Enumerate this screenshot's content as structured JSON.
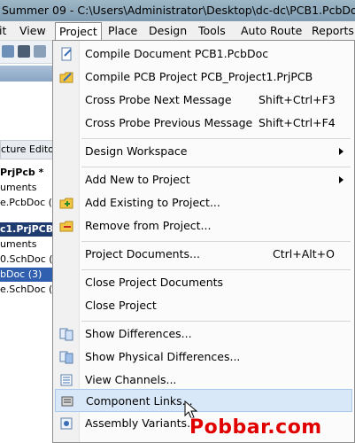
{
  "window": {
    "title": "Summer 09 - C:\\Users\\Administrator\\Desktop\\dc-dc\\PCB1.PcbDoc - P"
  },
  "menubar": {
    "items": [
      {
        "label": "it"
      },
      {
        "label": "View"
      },
      {
        "label": "Project"
      },
      {
        "label": "Place"
      },
      {
        "label": "Design"
      },
      {
        "label": "Tools"
      },
      {
        "label": "Auto Route"
      },
      {
        "label": "Reports"
      }
    ]
  },
  "left_panel": {
    "tab_label": "cture Editor",
    "rows": [
      "PrjPcb *",
      "uments",
      "e.PcbDoc (1",
      "c1.PrjPCB",
      "uments",
      "0.SchDoc (2",
      "bDoc (3)",
      "e.SchDoc (4"
    ]
  },
  "project_menu": {
    "items": [
      {
        "label": "Compile Document PCB1.PcbDoc",
        "shortcut": "",
        "icon": "compile-document-icon"
      },
      {
        "label": "Compile PCB Project PCB_Project1.PrjPCB",
        "shortcut": "",
        "icon": "compile-project-icon"
      },
      {
        "label": "Cross Probe Next Message",
        "shortcut": "Shift+Ctrl+F3",
        "icon": ""
      },
      {
        "label": "Cross Probe Previous Message",
        "shortcut": "Shift+Ctrl+F4",
        "icon": ""
      },
      {
        "label": "Design Workspace",
        "shortcut": "",
        "icon": "",
        "submenu": true
      },
      {
        "label": "Add New to Project",
        "shortcut": "",
        "icon": "",
        "submenu": true
      },
      {
        "label": "Add Existing to Project...",
        "shortcut": "",
        "icon": "add-existing-icon"
      },
      {
        "label": "Remove from Project...",
        "shortcut": "",
        "icon": "remove-from-project-icon"
      },
      {
        "label": "Project Documents...",
        "shortcut": "Ctrl+Alt+O",
        "icon": ""
      },
      {
        "label": "Close Project Documents",
        "shortcut": "",
        "icon": ""
      },
      {
        "label": "Close Project",
        "shortcut": "",
        "icon": ""
      },
      {
        "label": "Show Differences...",
        "shortcut": "",
        "icon": "show-differences-icon"
      },
      {
        "label": "Show Physical Differences...",
        "shortcut": "",
        "icon": "show-physical-differences-icon"
      },
      {
        "label": "View Channels...",
        "shortcut": "",
        "icon": "view-channels-icon"
      },
      {
        "label": "Component Links...",
        "shortcut": "",
        "icon": "component-links-icon",
        "highlighted": true
      },
      {
        "label": "Assembly Variants...",
        "shortcut": "",
        "icon": "assembly-variants-icon"
      }
    ]
  },
  "watermark": {
    "text": "Pobbar.com"
  },
  "colors": {
    "highlight": "#d9e8f8",
    "selected_tree_row": "#2f5fae",
    "watermark": "#e00000"
  }
}
